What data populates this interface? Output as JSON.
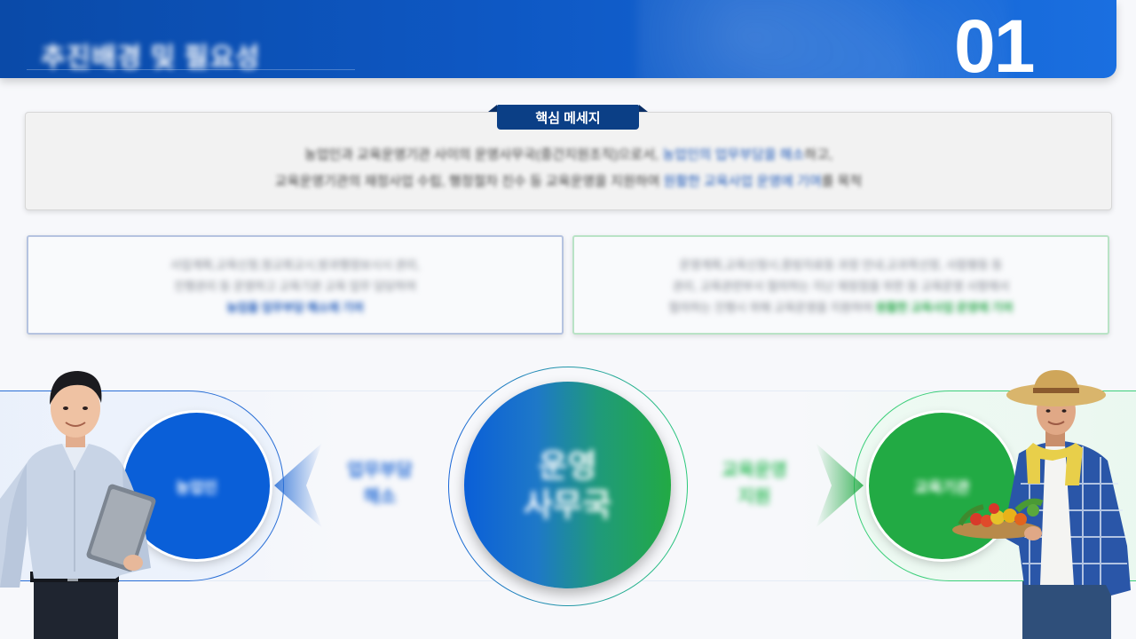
{
  "header": {
    "kicker": "",
    "title": "추진배경 및 필요성",
    "number": "01"
  },
  "key_message": {
    "tab_label": "핵심 메세지",
    "line1_pre": "농업인과 교육운영기관 사이의 운영사무국(중간지원조직)으로서, ",
    "line1_highlight": "농업인의 업무부담을 해소",
    "line1_post": "하고,",
    "line2_pre": "교육운영기관의 재정사업 수립, 행정절차 진수 등 교육운영을 지원하여 ",
    "line2_highlight": "원활한 교육사업 운영에 기여",
    "line2_post": "를 목적"
  },
  "left_box": {
    "line1": "사업계획,교육신청,청교회교시,방과행정보시시 관리,",
    "line2": "진행관리 등 운영하고 교육기관 교육 업무 담당하여",
    "highlight": "농업을 업무부담 해소에 기여"
  },
  "right_box": {
    "line1": "운영계획,교육신청시,증빙자료등 과정 안내,교과목선정, 사람평등 등",
    "line2": "관리, 교육관련부서 협의하는 지난 재정점을 위한 등 교육운영 사항에서",
    "line3_pre": "협의하는 진행시 위해 교육운영을 지원하여 ",
    "highlight": "원활한 교육사업 운영에 기여"
  },
  "diagram": {
    "left_circle": "농업인",
    "left_flow": [
      "업무부담",
      "해소"
    ],
    "center_circle": [
      "운영",
      "사무국"
    ],
    "right_flow": [
      "교육운영",
      "지원"
    ],
    "right_circle": "교육기관"
  },
  "colors": {
    "primary_blue": "#0a5fd8",
    "primary_green": "#22aa44",
    "header_blue": "#0e58c4",
    "tab_navy": "#0b3f86"
  }
}
